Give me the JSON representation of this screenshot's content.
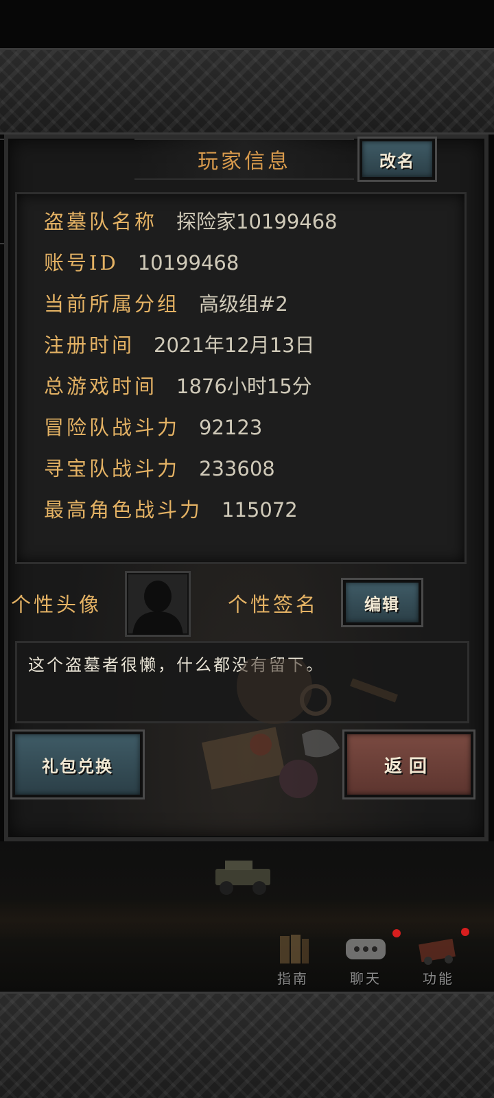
{
  "dialog": {
    "title": "玩家信息",
    "rename_label": "改名"
  },
  "info": {
    "rows": [
      {
        "label": "盗墓队名称",
        "value": "探险家10199468"
      },
      {
        "label": "账号ID",
        "value": "10199468"
      },
      {
        "label": "当前所属分组",
        "value": "高级组#2"
      },
      {
        "label": "注册时间",
        "value": "2021年12月13日"
      },
      {
        "label": "总游戏时间",
        "value": "1876小时15分"
      },
      {
        "label": "冒险队战斗力",
        "value": "92123"
      },
      {
        "label": "寻宝队战斗力",
        "value": "233608"
      },
      {
        "label": "最高角色战斗力",
        "value": "115072"
      }
    ]
  },
  "profile": {
    "avatar_label": "个性头像",
    "signature_label": "个性签名",
    "edit_label": "编辑",
    "signature_text": "这个盗墓者很懒，什么都没有留下。"
  },
  "actions": {
    "gift_label": "礼包兑换",
    "back_label": "返回"
  },
  "bottom_nav": {
    "items": [
      {
        "label": "指南",
        "icon": "book-icon",
        "badge": false
      },
      {
        "label": "聊天",
        "icon": "chat-icon",
        "badge": true
      },
      {
        "label": "功能",
        "icon": "cart-icon",
        "badge": true
      }
    ]
  },
  "colors": {
    "label_gold": "#e4b264",
    "title_orange": "#d89a4c",
    "button_blue": "#3f5b66",
    "button_red": "#7a4a41",
    "badge_red": "#d81e1e"
  }
}
